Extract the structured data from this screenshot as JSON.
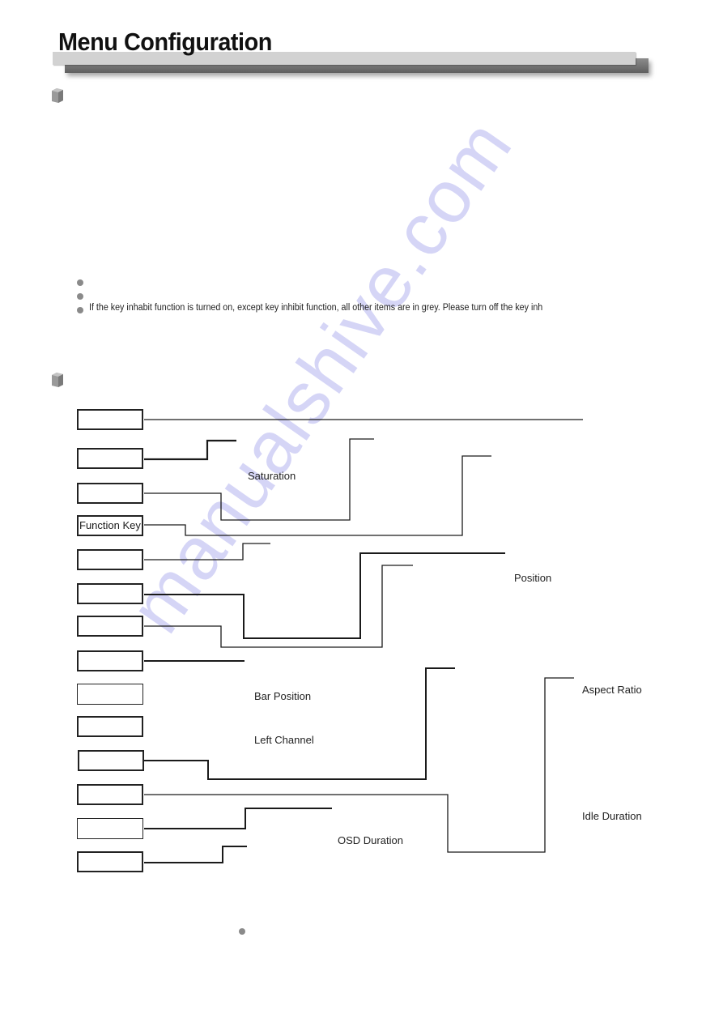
{
  "header": {
    "title": "Menu Configuration"
  },
  "notes": {
    "items": [
      "",
      "",
      "If the key inhabit function is turned on, except key inhibit function, all other items are in grey. Please turn off the key inh"
    ]
  },
  "menu_tree": {
    "boxes": [
      "",
      "",
      "",
      "Function Key",
      "",
      "",
      "",
      "",
      "",
      "",
      "",
      "",
      "",
      ""
    ],
    "labels": {
      "saturation": "Saturation",
      "position": "Position",
      "bar_position": "Bar Position",
      "left_channel": "Left Channel",
      "aspect_ratio": "Aspect Ratio",
      "idle_duration": "Idle Duration",
      "osd_duration": "OSD Duration"
    }
  },
  "footer_note": "",
  "watermark": "manualshive.com",
  "colors": {
    "header_bar": "#d2d2d2",
    "header_shadow": "#6e6e6e",
    "bullet": "#8a8a8a",
    "watermark": "#c8c8f4",
    "line": "#1a1a1a"
  }
}
